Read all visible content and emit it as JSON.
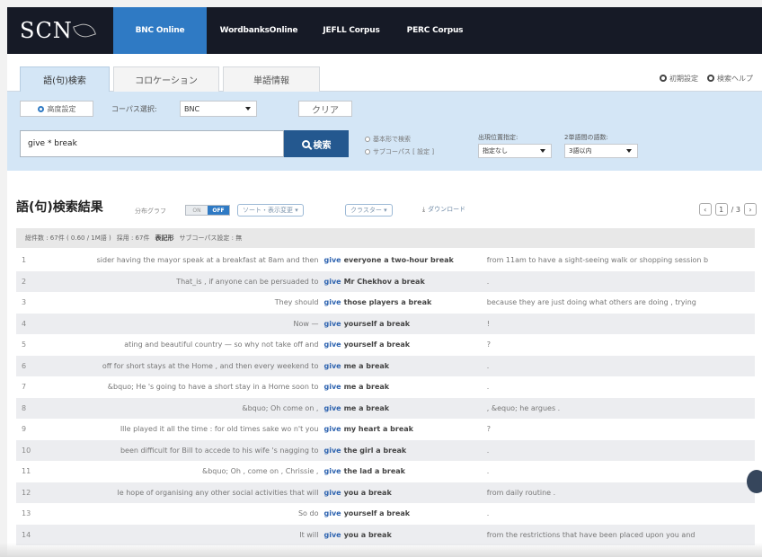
{
  "logo": "SCN",
  "nav": {
    "tabs": [
      "BNC Online",
      "WordbanksOnline",
      "JEFLL Corpus",
      "PERC Corpus"
    ],
    "active": "BNC Online"
  },
  "subtabs": {
    "items": [
      "語(句)検索",
      "コロケーション",
      "単語情報"
    ],
    "active": "語(句)検索"
  },
  "top_links": {
    "settings": "初期設定",
    "help": "検索ヘルプ"
  },
  "search": {
    "advanced_label": "高度設定",
    "corpus_label": "コーパス選択:",
    "corpus_value": "BNC",
    "clear_label": "クリア",
    "query": "give * break",
    "search_label": "検索",
    "opt_lemma": "基本形で検索",
    "opt_subcorpus": "サブコーパス [ 設定 ]",
    "genre_label": "出現位置指定:",
    "genre_value": "指定なし",
    "span_label": "2単語間の語数:",
    "span_value": "3語以内"
  },
  "results": {
    "title": "語(句)検索結果",
    "dist_graph_label": "分布グラフ",
    "toggle_on": "ON",
    "toggle_off": "OFF",
    "sort_label": "ソート・表示変更",
    "cluster_label": "クラスター",
    "download_label": "ダウンロード",
    "page_current": "1",
    "page_total": "/ 3",
    "stats_total": "総件数 : 67件 ( 0.60 / 1M語 )",
    "stats_adopted": "採用 : 67件",
    "stats_notation": "表記形",
    "stats_subcorpus": "サブコーパス設定 : 無"
  },
  "rows": [
    {
      "n": "1",
      "left": "sider having the mayor speak at a breakfast at 8am and then",
      "node": "give",
      "coll": "everyone a two-hour break",
      "right": "from 11am to have a sight-seeing walk or shopping session b"
    },
    {
      "n": "2",
      "left": "That_is , if anyone can be persuaded to",
      "node": "give",
      "coll": "Mr Chekhov a break",
      "right": "."
    },
    {
      "n": "3",
      "left": "They should",
      "node": "give",
      "coll": "those players a break",
      "right": "because they are just doing what others are doing , trying"
    },
    {
      "n": "4",
      "left": "Now —",
      "node": "give",
      "coll": "yourself a break",
      "right": "!"
    },
    {
      "n": "5",
      "left": "ating and beautiful country — so why not take off and",
      "node": "give",
      "coll": "yourself a break",
      "right": "?"
    },
    {
      "n": "6",
      "left": "off for short stays at the Home , and then every weekend to",
      "node": "give",
      "coll": "me a break",
      "right": "."
    },
    {
      "n": "7",
      "left": "&bquo; He 's going to have a short stay in a Home soon to",
      "node": "give",
      "coll": "me a break",
      "right": "."
    },
    {
      "n": "8",
      "left": "&bquo; Oh come on ,",
      "node": "give",
      "coll": "me a break",
      "right": ", &equo; he argues ."
    },
    {
      "n": "9",
      "left": "Ille played it all the time : for old times sake wo n't you",
      "node": "give",
      "coll": "my heart a break",
      "right": "?"
    },
    {
      "n": "10",
      "left": "been difficult for Bill to accede to his wife 's nagging to",
      "node": "give",
      "coll": "the girl a break",
      "right": "."
    },
    {
      "n": "11",
      "left": "&bquo; Oh , come on , Chrissie ,",
      "node": "give",
      "coll": "the lad a break",
      "right": "."
    },
    {
      "n": "12",
      "left": "le hope of organising any other social activities that will",
      "node": "give",
      "coll": "you a break",
      "right": "from daily routine ."
    },
    {
      "n": "13",
      "left": "So do",
      "node": "give",
      "coll": "yourself a break",
      "right": "."
    },
    {
      "n": "14",
      "left": "It will",
      "node": "give",
      "coll": "you a break",
      "right": "from the restrictions that have been placed upon you and"
    }
  ]
}
